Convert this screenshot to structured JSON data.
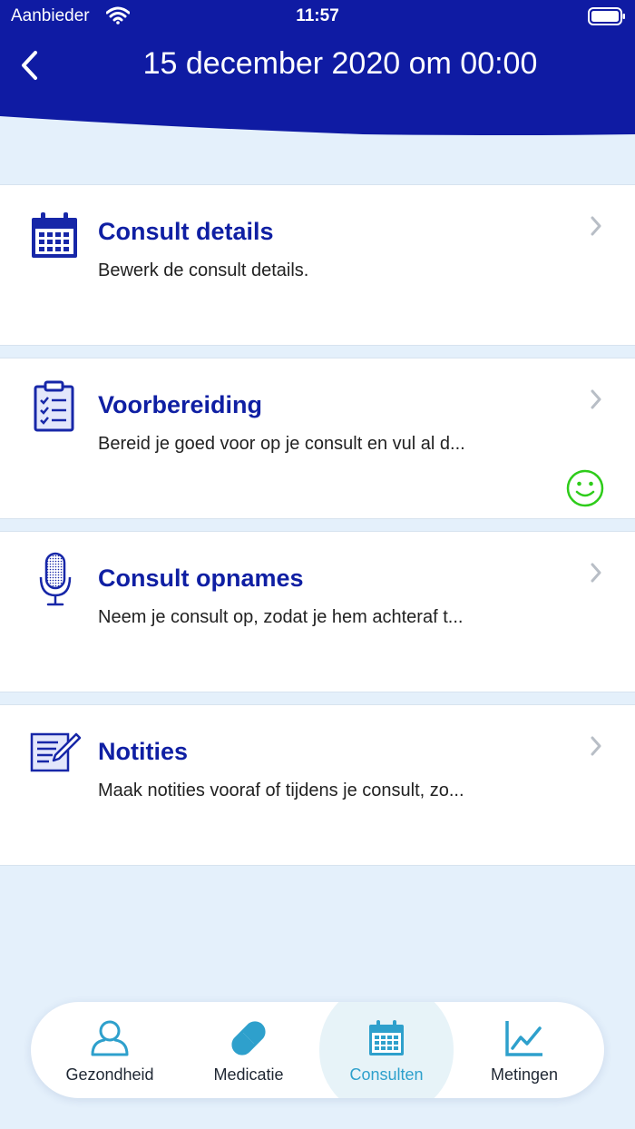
{
  "status_bar": {
    "carrier": "Aanbieder",
    "time": "11:57"
  },
  "header": {
    "title": "15 december 2020 om 00:00"
  },
  "colors": {
    "header_bg": "#0f1ba3",
    "title_blue": "#0f1fa3",
    "tab_active": "#2ea0cc",
    "smiley_green": "#2ecc1a",
    "page_bg": "#e4f0fb"
  },
  "items": [
    {
      "title": "Consult details",
      "description": "Bewerk de consult details.",
      "icon": "calendar-icon"
    },
    {
      "title": "Voorbereiding",
      "description": "Bereid je goed voor op je consult en vul al d...",
      "icon": "clipboard-checklist-icon",
      "status_icon": "smiley-icon"
    },
    {
      "title": "Consult opnames",
      "description": "Neem je consult op, zodat je hem achteraf t...",
      "icon": "microphone-icon"
    },
    {
      "title": "Notities",
      "description": "Maak notities vooraf of tijdens je consult, zo...",
      "icon": "notes-pencil-icon"
    }
  ],
  "tabs": [
    {
      "label": "Gezondheid",
      "icon": "person-icon"
    },
    {
      "label": "Medicatie",
      "icon": "pill-icon"
    },
    {
      "label": "Consulten",
      "icon": "calendar-icon",
      "active": true
    },
    {
      "label": "Metingen",
      "icon": "line-chart-icon"
    }
  ]
}
